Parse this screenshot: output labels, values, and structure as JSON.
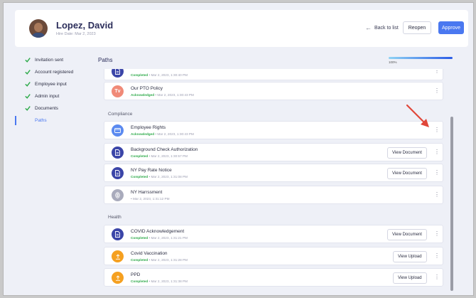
{
  "header": {
    "name": "Lopez, David",
    "hire_date": "Hire Date: Mar 2, 2023",
    "back_label": "Back to list",
    "reopen_label": "Reopen",
    "approve_label": "Approve"
  },
  "sidebar": {
    "items": [
      {
        "label": "Invitation sent"
      },
      {
        "label": "Account registered"
      },
      {
        "label": "Employee input"
      },
      {
        "label": "Admin input"
      },
      {
        "label": "Documents"
      },
      {
        "label": "Paths"
      }
    ]
  },
  "main": {
    "title": "Paths",
    "progress_label": "100%",
    "progress_value": 1.0,
    "top_cards": [
      {
        "title": "",
        "status": "Completed",
        "date": "• Mar 2, 2023, 1:30:40 PM",
        "icon": "document-icon",
        "color": "#3b45a8"
      },
      {
        "title": "Our PTO Policy",
        "status": "Acknowledged",
        "date": "• Mar 2, 2023, 1:30:43 PM",
        "icon": "tv-icon",
        "color": "#f08a78",
        "icon_text": "Tv"
      }
    ],
    "sections": [
      {
        "name": "Compliance",
        "items": [
          {
            "title": "Employee Rights",
            "status": "Acknowledged",
            "date": "• Mar 2, 2023, 1:30:43 PM",
            "icon": "browser-icon",
            "color": "#5b8af0",
            "action": ""
          },
          {
            "title": "Background Check Authorization",
            "status": "Completed",
            "date": "• Mar 2, 2023, 1:30:57 PM",
            "icon": "document-icon",
            "color": "#3b45a8",
            "action": "View Document"
          },
          {
            "title": "NY Pay Rate Notice",
            "status": "Completed",
            "date": "• Mar 2, 2023, 1:31:08 PM",
            "icon": "document-icon",
            "color": "#3b45a8",
            "action": "View Document"
          },
          {
            "title": "NY Harrssment",
            "status": "",
            "date": "• Mar 2, 2023, 1:31:12 PM",
            "icon": "fingerprint-icon",
            "color": "#a9abbc",
            "action": ""
          }
        ]
      },
      {
        "name": "Health",
        "items": [
          {
            "title": "COVID Acknowledgement",
            "status": "Completed",
            "date": "• Mar 2, 2023, 1:31:21 PM",
            "icon": "document-icon",
            "color": "#3b45a8",
            "action": "View Document"
          },
          {
            "title": "Covid Vaccination",
            "status": "Completed",
            "date": "• Mar 2, 2023, 1:31:28 PM",
            "icon": "upload-icon",
            "color": "#f5a020",
            "action": "View Upload"
          },
          {
            "title": "PPD",
            "status": "Completed",
            "date": "• Mar 2, 2023, 1:31:38 PM",
            "icon": "upload-icon",
            "color": "#f5a020",
            "action": "View Upload"
          }
        ]
      }
    ]
  },
  "colors": {
    "accent": "#4a78f0",
    "completed": "#2eaa4a",
    "annotation_arrow": "#e0473a"
  }
}
